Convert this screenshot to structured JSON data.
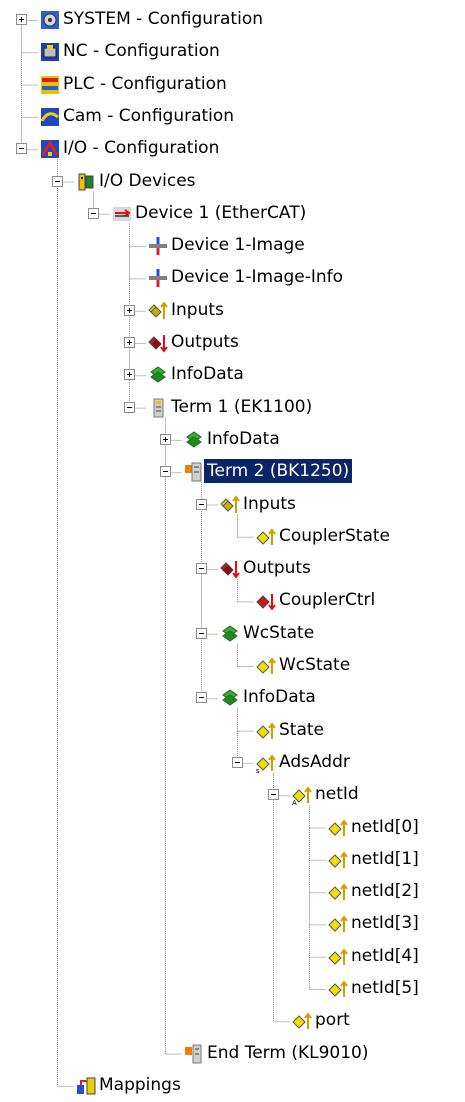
{
  "tree": {
    "nodes": [
      {
        "label": "SYSTEM - Configuration",
        "icon": "system-config-icon",
        "expander": "plus"
      },
      {
        "label": "NC - Configuration",
        "icon": "nc-config-icon",
        "expander": null
      },
      {
        "label": "PLC - Configuration",
        "icon": "plc-config-icon",
        "expander": null
      },
      {
        "label": "Cam - Configuration",
        "icon": "cam-config-icon",
        "expander": null
      },
      {
        "label": "I/O - Configuration",
        "icon": "io-config-icon",
        "expander": "minus"
      },
      {
        "label": "I/O Devices",
        "icon": "io-devices-icon",
        "expander": "minus"
      },
      {
        "label": "Device 1 (EtherCAT)",
        "icon": "ethercat-device-icon",
        "expander": "minus"
      },
      {
        "label": "Device 1-Image",
        "icon": "process-image-icon",
        "expander": null
      },
      {
        "label": "Device 1-Image-Info",
        "icon": "process-image-icon",
        "expander": null
      },
      {
        "label": "Inputs",
        "icon": "inputs-icon",
        "expander": "plus"
      },
      {
        "label": "Outputs",
        "icon": "outputs-icon",
        "expander": "plus"
      },
      {
        "label": "InfoData",
        "icon": "infodata-icon",
        "expander": "plus"
      },
      {
        "label": "Term 1 (EK1100)",
        "icon": "terminal-icon",
        "expander": "minus"
      },
      {
        "label": "InfoData",
        "icon": "infodata-icon",
        "expander": "plus"
      },
      {
        "label": "Term 2 (BK1250)",
        "icon": "terminal-orange-icon",
        "expander": "minus",
        "selected": true
      },
      {
        "label": "Inputs",
        "icon": "inputs-icon",
        "expander": "minus"
      },
      {
        "label": "CouplerState",
        "icon": "input-variable-icon",
        "expander": null
      },
      {
        "label": "Outputs",
        "icon": "outputs-icon",
        "expander": "minus"
      },
      {
        "label": "CouplerCtrl",
        "icon": "output-variable-icon",
        "expander": null
      },
      {
        "label": "WcState",
        "icon": "infodata-icon",
        "expander": "minus"
      },
      {
        "label": "WcState",
        "icon": "input-variable-icon",
        "expander": null
      },
      {
        "label": "InfoData",
        "icon": "infodata-icon",
        "expander": "minus"
      },
      {
        "label": "State",
        "icon": "input-variable-icon",
        "expander": null
      },
      {
        "label": "AdsAddr",
        "icon": "struct-variable-icon",
        "expander": "minus"
      },
      {
        "label": "netId",
        "icon": "array-variable-icon",
        "expander": "minus"
      },
      {
        "label": "netId[0]",
        "icon": "input-variable-icon",
        "expander": null
      },
      {
        "label": "netId[1]",
        "icon": "input-variable-icon",
        "expander": null
      },
      {
        "label": "netId[2]",
        "icon": "input-variable-icon",
        "expander": null
      },
      {
        "label": "netId[3]",
        "icon": "input-variable-icon",
        "expander": null
      },
      {
        "label": "netId[4]",
        "icon": "input-variable-icon",
        "expander": null
      },
      {
        "label": "netId[5]",
        "icon": "input-variable-icon",
        "expander": null
      },
      {
        "label": "port",
        "icon": "input-variable-icon",
        "expander": null
      },
      {
        "label": "End Term (KL9010)",
        "icon": "end-terminal-icon",
        "expander": null
      },
      {
        "label": "Mappings",
        "icon": "mappings-icon",
        "expander": null
      }
    ]
  },
  "colors": {
    "selection_bg": "#0a246a",
    "selection_fg": "#ffffff",
    "tree_line": "#808080",
    "input_yellow": "#e8d400",
    "output_red": "#cc1010",
    "infodata_green": "#2a9a2a"
  }
}
